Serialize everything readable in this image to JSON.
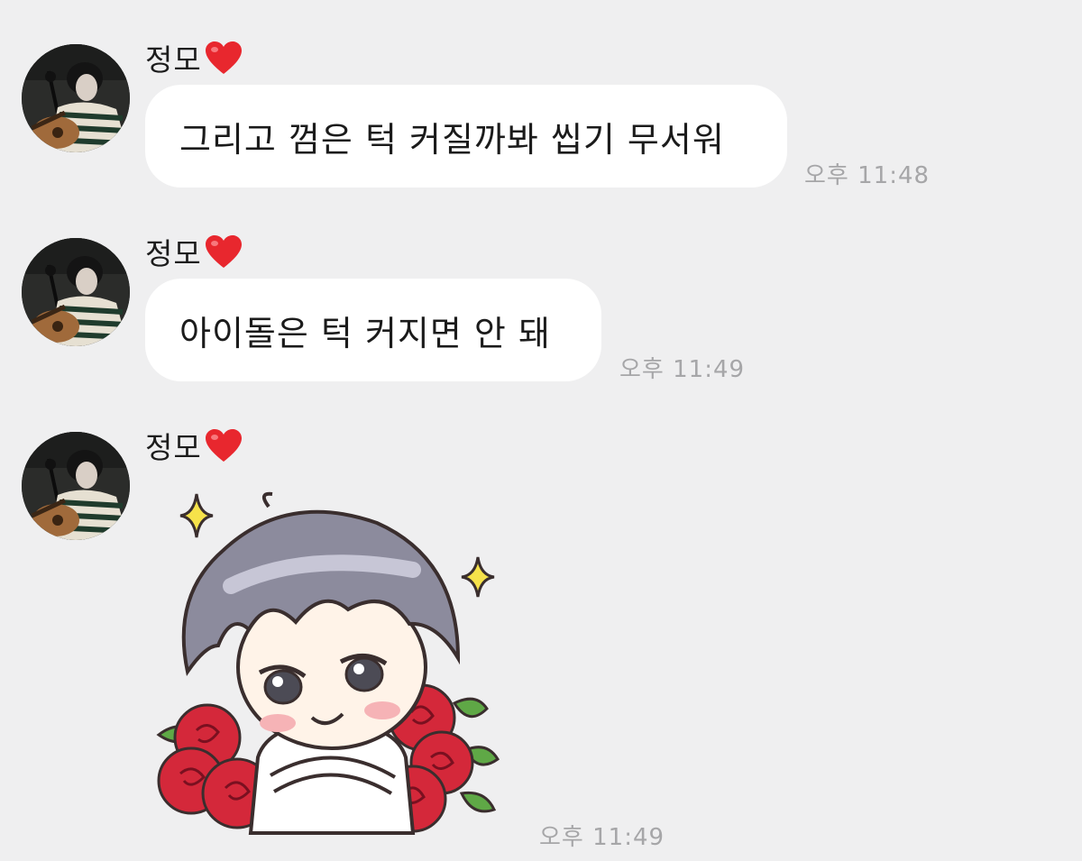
{
  "chat": {
    "messages": [
      {
        "sender": "정모",
        "sender_emoji_icon": "red-heart-icon",
        "type": "text",
        "text": "그리고 껌은 턱 커질까봐 씹기 무서워",
        "time": "오후 11:48"
      },
      {
        "sender": "정모",
        "sender_emoji_icon": "red-heart-icon",
        "type": "text",
        "text": "아이돌은 턱 커지면 안 돼",
        "time": "오후 11:49"
      },
      {
        "sender": "정모",
        "sender_emoji_icon": "red-heart-icon",
        "type": "sticker",
        "sticker_description_icon": "chibi-character-with-roses-sticker",
        "time": "오후 11:49"
      }
    ]
  },
  "colors": {
    "background": "#efeff0",
    "bubble": "#ffffff",
    "heart": "#e8272e",
    "timestamp": "#a6a6a8",
    "text": "#1b1b1b"
  }
}
